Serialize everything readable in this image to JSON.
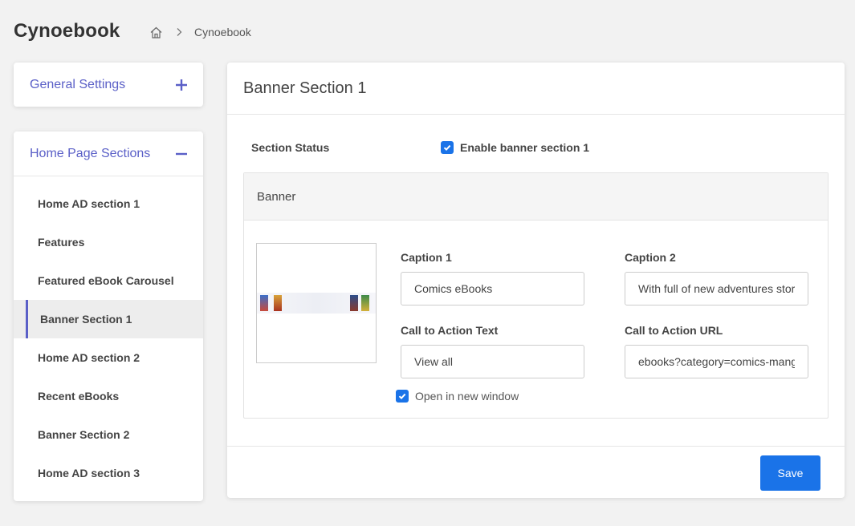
{
  "app": {
    "title": "Cynoebook"
  },
  "breadcrumb": {
    "home_icon": "home-icon",
    "separator_icon": "chevron-right-icon",
    "current": "Cynoebook"
  },
  "sidebar": {
    "general": {
      "title": "General Settings",
      "toggle_icon": "plus-icon"
    },
    "home_sections": {
      "title": "Home Page Sections",
      "toggle_icon": "minus-icon",
      "items": [
        {
          "label": "Home AD section 1"
        },
        {
          "label": "Features"
        },
        {
          "label": "Featured eBook Carousel"
        },
        {
          "label": "Banner Section 1",
          "active": true
        },
        {
          "label": "Home AD section 2"
        },
        {
          "label": "Recent eBooks"
        },
        {
          "label": "Banner Section 2"
        },
        {
          "label": "Home AD section 3"
        }
      ]
    }
  },
  "main": {
    "title": "Banner Section 1",
    "status": {
      "label": "Section Status",
      "checkbox_label": "Enable banner section 1",
      "checked": true
    },
    "banner": {
      "header": "Banner",
      "caption1": {
        "label": "Caption 1",
        "value": "Comics eBooks"
      },
      "caption2": {
        "label": "Caption 2",
        "value": "With full of new adventures stories"
      },
      "cta_text": {
        "label": "Call to Action Text",
        "value": "View all"
      },
      "cta_url": {
        "label": "Call to Action URL",
        "value": "ebooks?category=comics-manga"
      },
      "new_window": {
        "label": "Open in new window",
        "checked": true
      }
    },
    "save_label": "Save"
  },
  "colors": {
    "accent": "#5a5fc7",
    "primary": "#1a73e8",
    "background": "#f2f2f2"
  }
}
